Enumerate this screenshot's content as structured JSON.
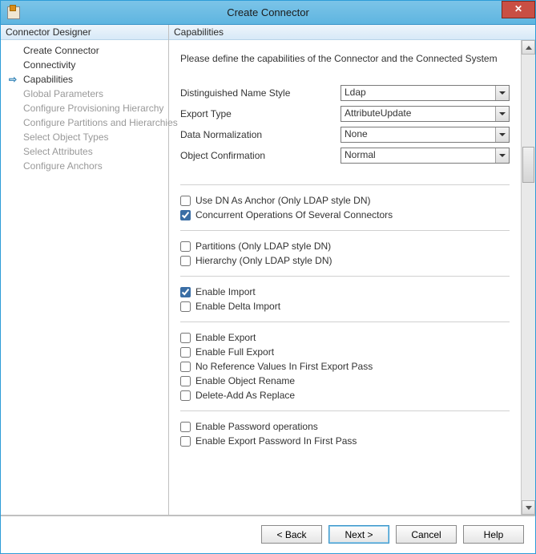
{
  "window": {
    "title": "Create Connector"
  },
  "sidebar": {
    "header": "Connector Designer",
    "items": [
      {
        "label": "Create Connector",
        "state": "normal"
      },
      {
        "label": "Connectivity",
        "state": "normal"
      },
      {
        "label": "Capabilities",
        "state": "current"
      },
      {
        "label": "Global Parameters",
        "state": "disabled"
      },
      {
        "label": "Configure Provisioning Hierarchy",
        "state": "disabled"
      },
      {
        "label": "Configure Partitions and Hierarchies",
        "state": "disabled"
      },
      {
        "label": "Select Object Types",
        "state": "disabled"
      },
      {
        "label": "Select Attributes",
        "state": "disabled"
      },
      {
        "label": "Configure Anchors",
        "state": "disabled"
      }
    ]
  },
  "content": {
    "header": "Capabilities",
    "intro": "Please define the capabilities of the Connector and the Connected System",
    "dropdowns": [
      {
        "label": "Distinguished Name Style",
        "value": "Ldap"
      },
      {
        "label": "Export Type",
        "value": "AttributeUpdate"
      },
      {
        "label": "Data Normalization",
        "value": "None"
      },
      {
        "label": "Object Confirmation",
        "value": "Normal"
      }
    ],
    "groups": [
      [
        {
          "label": "Use DN As Anchor (Only LDAP style DN)",
          "checked": false
        },
        {
          "label": "Concurrent Operations Of Several Connectors",
          "checked": true
        }
      ],
      [
        {
          "label": "Partitions (Only LDAP style DN)",
          "checked": false
        },
        {
          "label": "Hierarchy (Only LDAP style DN)",
          "checked": false
        }
      ],
      [
        {
          "label": "Enable Import",
          "checked": true
        },
        {
          "label": "Enable Delta Import",
          "checked": false
        }
      ],
      [
        {
          "label": "Enable Export",
          "checked": false
        },
        {
          "label": "Enable Full Export",
          "checked": false
        },
        {
          "label": "No Reference Values In First Export Pass",
          "checked": false
        },
        {
          "label": "Enable Object Rename",
          "checked": false
        },
        {
          "label": "Delete-Add As Replace",
          "checked": false
        }
      ],
      [
        {
          "label": "Enable Password operations",
          "checked": false
        },
        {
          "label": "Enable Export Password In First Pass",
          "checked": false
        }
      ]
    ]
  },
  "buttons": {
    "back": "<  Back",
    "next": "Next  >",
    "cancel": "Cancel",
    "help": "Help"
  }
}
